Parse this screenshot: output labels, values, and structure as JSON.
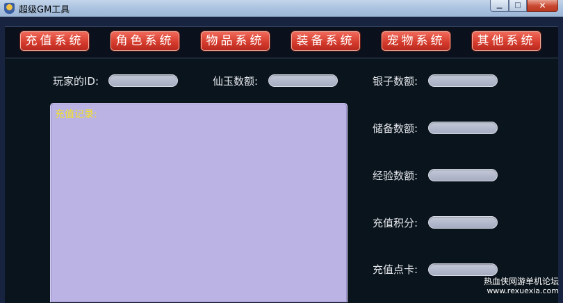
{
  "window": {
    "title": "超级GM工具",
    "minimize_glyph": "▁",
    "maximize_glyph": "□",
    "close_glyph": "✕"
  },
  "toolbar": {
    "buttons": [
      {
        "label": "充值系统"
      },
      {
        "label": "角色系统"
      },
      {
        "label": "物品系统"
      },
      {
        "label": "装备系统"
      },
      {
        "label": "宠物系统"
      },
      {
        "label": "其他系统"
      }
    ]
  },
  "form": {
    "player_id": {
      "label": "玩家的ID:",
      "value": ""
    },
    "xianyu": {
      "label": "仙玉数额:",
      "value": ""
    },
    "silver": {
      "label": "银子数额:",
      "value": ""
    },
    "reserve": {
      "label": "储备数额:",
      "value": ""
    },
    "experience": {
      "label": "经验数额:",
      "value": ""
    },
    "points": {
      "label": "充值积分:",
      "value": ""
    },
    "card": {
      "label": "充值点卡:",
      "value": ""
    }
  },
  "record": {
    "label": "充值记录:"
  },
  "watermark": {
    "line1": "热血侠网游单机论坛",
    "line2": "www.rexuexia.com"
  }
}
